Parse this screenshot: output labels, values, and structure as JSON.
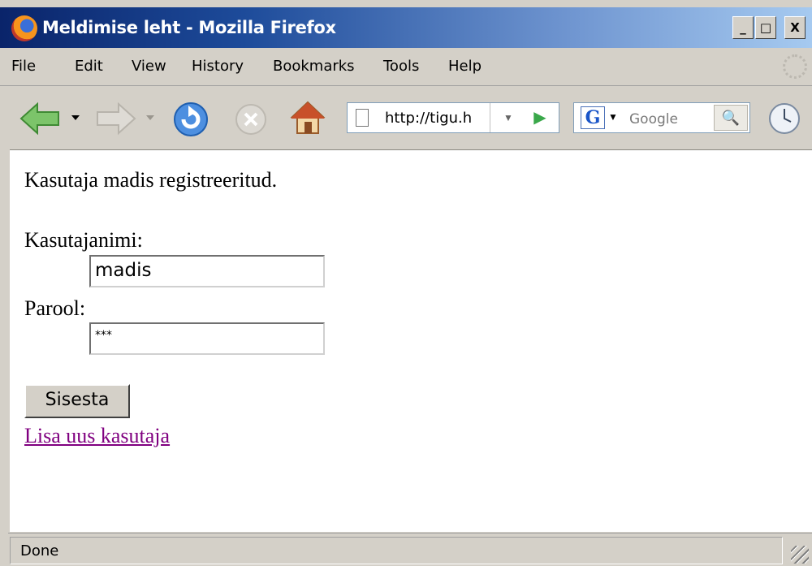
{
  "window": {
    "title": "Meldimise leht - Mozilla Firefox",
    "controls": {
      "minimize": "_",
      "maximize": "□",
      "close": "X"
    }
  },
  "menu": {
    "items": [
      "File",
      "Edit",
      "View",
      "History",
      "Bookmarks",
      "Tools",
      "Help"
    ]
  },
  "toolbar": {
    "url": "http://tigu.h",
    "search_placeholder": "Google",
    "search_engine_logo": "G",
    "icons": [
      "back-arrow-icon",
      "forward-arrow-icon",
      "reload-icon",
      "stop-icon",
      "home-icon",
      "go-icon",
      "search-icon",
      "history-clock-icon"
    ]
  },
  "page": {
    "message": "Kasutaja madis registreeritud.",
    "username_label": "Kasutajanimi:",
    "username_value": "madis",
    "password_label": "Parool:",
    "password_value": "***",
    "submit_label": "Sisesta",
    "add_user_link": "Lisa uus kasutaja",
    "link_color": "#800080"
  },
  "statusbar": {
    "text": "Done"
  }
}
